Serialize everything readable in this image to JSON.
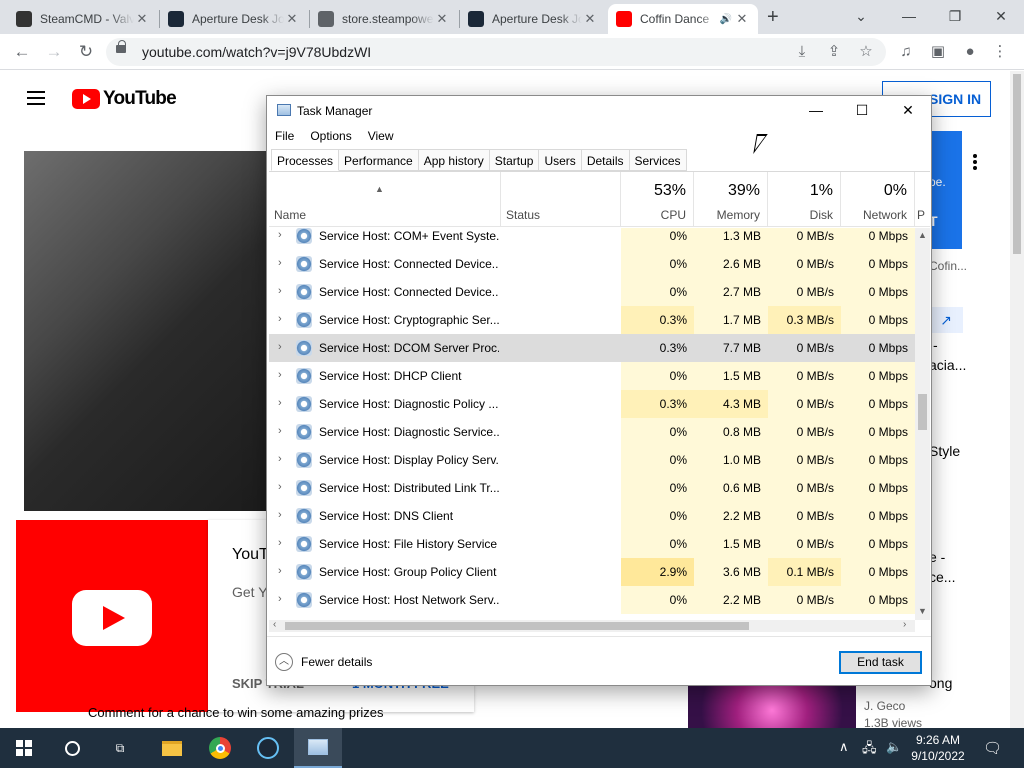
{
  "browser": {
    "tabs": [
      {
        "title": "SteamCMD - Valve Developer Community",
        "icon": "steam-cmd-icon",
        "icon_color": "#333333",
        "active": false
      },
      {
        "title": "Aperture Desk Job",
        "icon": "steam-icon",
        "icon_color": "#1b2838",
        "active": false
      },
      {
        "title": "store.steampowered.com",
        "icon": "globe-icon",
        "icon_color": "#5f6368",
        "active": false
      },
      {
        "title": "Aperture Desk Job",
        "icon": "steam-icon",
        "icon_color": "#1b2838",
        "active": false
      },
      {
        "title": "Coffin Dance",
        "icon": "youtube-icon",
        "icon_color": "#ff0000",
        "active": true
      }
    ],
    "url": "youtube.com/watch?v=j9V78UbdzWI"
  },
  "youtube": {
    "logo_text": "YouTube",
    "sign_in": "SIGN IN",
    "ad_title": "YouT",
    "ad_sub": "Get Y",
    "ad_skip": "SKIP TRIAL",
    "ad_cta": "1 MONTH FREE",
    "comment": "Comment for a chance to win some amazing prizes",
    "sidebar": {
      "pe": "pe.",
      "t": "T",
      "cofin": "Cofin...",
      "dash": "-",
      "acia": "acia...",
      "style": "Style",
      "e_dash": "e -",
      "ce": "ce...",
      "song": "ong",
      "channel": "J. Geco",
      "views": "1.3B views"
    }
  },
  "taskmanager": {
    "title": "Task Manager",
    "menu": [
      "File",
      "Options",
      "View"
    ],
    "tabs": [
      "Processes",
      "Performance",
      "App history",
      "Startup",
      "Users",
      "Details",
      "Services"
    ],
    "columns": {
      "name": "Name",
      "status": "Status",
      "cpu": {
        "pct": "53%",
        "label": "CPU"
      },
      "memory": {
        "pct": "39%",
        "label": "Memory"
      },
      "disk": {
        "pct": "1%",
        "label": "Disk"
      },
      "network": {
        "pct": "0%",
        "label": "Network"
      },
      "power": "P"
    },
    "rows": [
      {
        "name": "Service Host: COM+ Event Syste...",
        "cpu": "0%",
        "mem": "1.3 MB",
        "disk": "0 MB/s",
        "net": "0 Mbps"
      },
      {
        "name": "Service Host: Connected Device...",
        "cpu": "0%",
        "mem": "2.6 MB",
        "disk": "0 MB/s",
        "net": "0 Mbps"
      },
      {
        "name": "Service Host: Connected Device...",
        "cpu": "0%",
        "mem": "2.7 MB",
        "disk": "0 MB/s",
        "net": "0 Mbps"
      },
      {
        "name": "Service Host: Cryptographic Ser...",
        "cpu": "0.3%",
        "mem": "1.7 MB",
        "disk": "0.3 MB/s",
        "net": "0 Mbps"
      },
      {
        "name": "Service Host: DCOM Server Proc...",
        "cpu": "0.3%",
        "mem": "7.7 MB",
        "disk": "0 MB/s",
        "net": "0 Mbps",
        "selected": true
      },
      {
        "name": "Service Host: DHCP Client",
        "cpu": "0%",
        "mem": "1.5 MB",
        "disk": "0 MB/s",
        "net": "0 Mbps"
      },
      {
        "name": "Service Host: Diagnostic Policy ...",
        "cpu": "0.3%",
        "mem": "4.3 MB",
        "disk": "0 MB/s",
        "net": "0 Mbps"
      },
      {
        "name": "Service Host: Diagnostic Service...",
        "cpu": "0%",
        "mem": "0.8 MB",
        "disk": "0 MB/s",
        "net": "0 Mbps"
      },
      {
        "name": "Service Host: Display Policy Serv...",
        "cpu": "0%",
        "mem": "1.0 MB",
        "disk": "0 MB/s",
        "net": "0 Mbps"
      },
      {
        "name": "Service Host: Distributed Link Tr...",
        "cpu": "0%",
        "mem": "0.6 MB",
        "disk": "0 MB/s",
        "net": "0 Mbps"
      },
      {
        "name": "Service Host: DNS Client",
        "cpu": "0%",
        "mem": "2.2 MB",
        "disk": "0 MB/s",
        "net": "0 Mbps"
      },
      {
        "name": "Service Host: File History Service",
        "cpu": "0%",
        "mem": "1.5 MB",
        "disk": "0 MB/s",
        "net": "0 Mbps"
      },
      {
        "name": "Service Host: Group Policy Client",
        "cpu": "2.9%",
        "mem": "3.6 MB",
        "disk": "0.1 MB/s",
        "net": "0 Mbps"
      },
      {
        "name": "Service Host: Host Network Serv...",
        "cpu": "0%",
        "mem": "2.2 MB",
        "disk": "0 MB/s",
        "net": "0 Mbps"
      }
    ],
    "fewer_details": "Fewer details",
    "end_task": "End task",
    "colors": {
      "heat_light": "#fff9d8",
      "heat_mid": "#fff1b8",
      "heat_high": "#ffe89a",
      "selected": "#dcdcdc"
    }
  },
  "taskbar": {
    "time": "9:26 AM",
    "date": "9/10/2022",
    "color": "#1f2f3e"
  }
}
